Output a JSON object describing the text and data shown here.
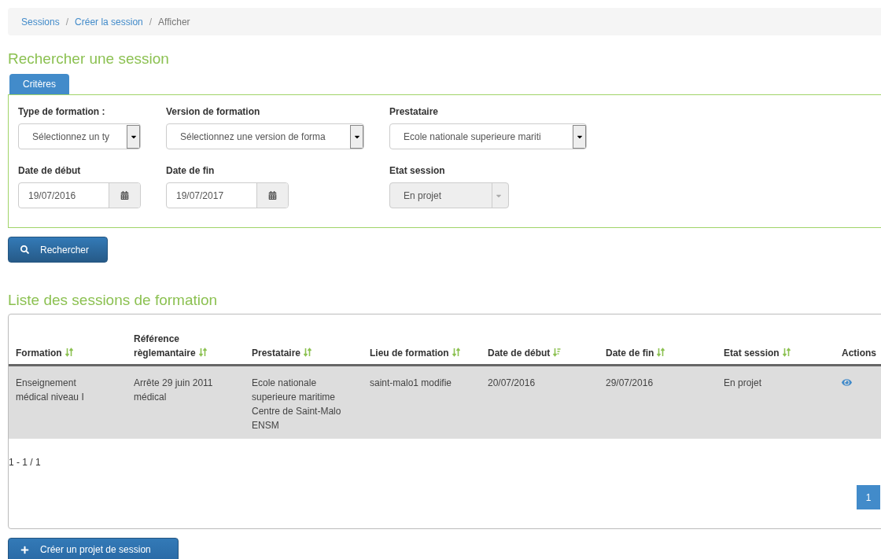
{
  "breadcrumb": [
    {
      "label": "Sessions",
      "current": false
    },
    {
      "label": "Créer la session",
      "current": false
    },
    {
      "label": "Afficher",
      "current": true
    }
  ],
  "breadcrumb_separator": "/",
  "search_title": "Rechercher une session",
  "tabs": [
    {
      "label": "Critères",
      "selected": true
    }
  ],
  "criteria": [
    {
      "kind": "select",
      "label": "Type de formation :",
      "value": "Sélectionnez un ty",
      "disabled": false
    },
    {
      "kind": "select",
      "label": "Version de formation",
      "value": "Sélectionnez une version de forma",
      "disabled": false
    },
    {
      "kind": "select",
      "label": "Prestataire",
      "value": "Ecole nationale superieure mariti",
      "disabled": false
    },
    {
      "kind": "date",
      "label": "Date de début",
      "value": "19/07/2016",
      "disabled": false
    },
    {
      "kind": "date",
      "label": "Date de fin",
      "value": "19/07/2017",
      "disabled": false
    },
    {
      "kind": "select",
      "label": "Etat session",
      "value": "En projet",
      "disabled": true
    }
  ],
  "search_button": "Rechercher",
  "list_title": "Liste des sessions de formation",
  "table": {
    "columns": [
      {
        "label": "Formation",
        "sortable": true,
        "sorted": false
      },
      {
        "label": "Référence\nrèglemantaire",
        "sortable": true,
        "sorted": false
      },
      {
        "label": "Prestataire",
        "sortable": true,
        "sorted": false
      },
      {
        "label": "Lieu de formation",
        "sortable": true,
        "sorted": false
      },
      {
        "label": "Date de début",
        "sortable": true,
        "sorted": true
      },
      {
        "label": "Date de fin",
        "sortable": true,
        "sorted": false
      },
      {
        "label": "Etat session",
        "sortable": true,
        "sorted": false
      },
      {
        "label": "Actions",
        "sortable": false
      }
    ],
    "rows": [
      {
        "cells": [
          "Enseignement\nmédical niveau I",
          "Arrête 29 juin 2011\nmédical",
          "Ecole nationale\nsuperieure maritime\nCentre de Saint-Malo\nENSM",
          "saint-malo1 modifie",
          "20/07/2016",
          "29/07/2016",
          "En projet"
        ],
        "selected": true
      }
    ]
  },
  "count": "1 - 1 / 1",
  "pages": [
    {
      "label": "1",
      "selected": true
    }
  ],
  "create_button": "Créer un projet de session"
}
